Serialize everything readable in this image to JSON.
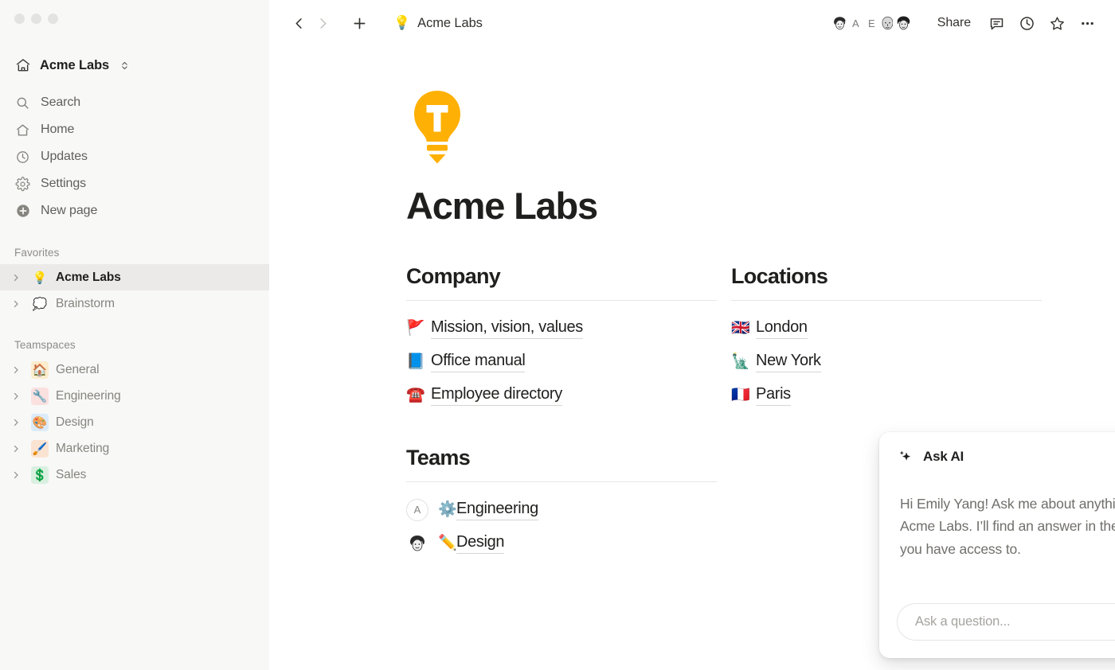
{
  "window": {
    "traffic_lights": [
      "close",
      "minimize",
      "maximize"
    ]
  },
  "sidebar": {
    "workspace": {
      "name": "Acme Labs",
      "icon": "house-icon",
      "switcher_icon": "chevron-up-down-icon"
    },
    "nav": [
      {
        "label": "Search",
        "icon": "search-icon"
      },
      {
        "label": "Home",
        "icon": "home-icon"
      },
      {
        "label": "Updates",
        "icon": "clock-icon"
      },
      {
        "label": "Settings",
        "icon": "gear-icon"
      },
      {
        "label": "New page",
        "icon": "plus-circle-icon"
      }
    ],
    "favorites": {
      "title": "Favorites",
      "items": [
        {
          "label": "Acme Labs",
          "emoji": "💡",
          "active": true,
          "emoji_bg": "transparent"
        },
        {
          "label": "Brainstorm",
          "emoji": "💭",
          "active": false,
          "emoji_bg": "transparent"
        }
      ]
    },
    "teamspaces": {
      "title": "Teamspaces",
      "items": [
        {
          "label": "General",
          "emoji": "🏠",
          "emoji_bg": "#fdeccd"
        },
        {
          "label": "Engineering",
          "emoji": "🔧",
          "emoji_bg": "#fbe0e0"
        },
        {
          "label": "Design",
          "emoji": "🎨",
          "emoji_bg": "#dcebfa"
        },
        {
          "label": "Marketing",
          "emoji": "🖌️",
          "emoji_bg": "#fbe3d2"
        },
        {
          "label": "Sales",
          "emoji": "💲",
          "emoji_bg": "#d9f0e0"
        }
      ]
    }
  },
  "topbar": {
    "back_icon": "chevron-left-icon",
    "forward_icon": "chevron-right-icon",
    "new_icon": "plus-icon",
    "breadcrumb": {
      "emoji": "💡",
      "label": "Acme Labs"
    },
    "avatars": [
      {
        "type": "face",
        "label": ""
      },
      {
        "type": "initial",
        "label": "A"
      },
      {
        "type": "initial",
        "label": "E"
      },
      {
        "type": "face",
        "label": ""
      },
      {
        "type": "face",
        "label": ""
      }
    ],
    "share_label": "Share",
    "icons": [
      {
        "name": "comment-icon"
      },
      {
        "name": "history-icon"
      },
      {
        "name": "star-icon"
      },
      {
        "name": "more-icon"
      }
    ]
  },
  "page": {
    "icon_emoji": "💡",
    "icon_color": "#ffb004",
    "title": "Acme Labs",
    "columns": [
      {
        "heading": "Company",
        "links": [
          {
            "emoji": "🚩",
            "label": "Mission, vision, values"
          },
          {
            "emoji": "📘",
            "label": "Office manual"
          },
          {
            "emoji": "☎️",
            "label": "Employee directory"
          }
        ]
      },
      {
        "heading": "Locations",
        "links": [
          {
            "emoji": "🇬🇧",
            "label": "London"
          },
          {
            "emoji": "🗽",
            "label": "New York"
          },
          {
            "emoji": "🇫🇷",
            "label": "Paris"
          }
        ]
      }
    ],
    "teams": {
      "heading": "Teams",
      "rows": [
        {
          "avatar_type": "initial",
          "avatar_label": "A",
          "emoji": "⚙️",
          "label": "Engineering"
        },
        {
          "avatar_type": "face",
          "avatar_label": "",
          "emoji": "✏️",
          "label": "Design"
        }
      ]
    }
  },
  "ask_ai": {
    "title": "Ask AI",
    "sparkle_icon": "sparkle-icon",
    "header_icons": [
      {
        "name": "history-icon"
      },
      {
        "name": "more-icon"
      },
      {
        "name": "close-icon"
      }
    ],
    "greeting": "Hi Emily Yang! Ask me about anything in Acme Labs. I’ll find an answer in the pages you have access to.",
    "input_placeholder": "Ask a question...",
    "input_value": "",
    "send_icon": "arrow-up-icon"
  }
}
